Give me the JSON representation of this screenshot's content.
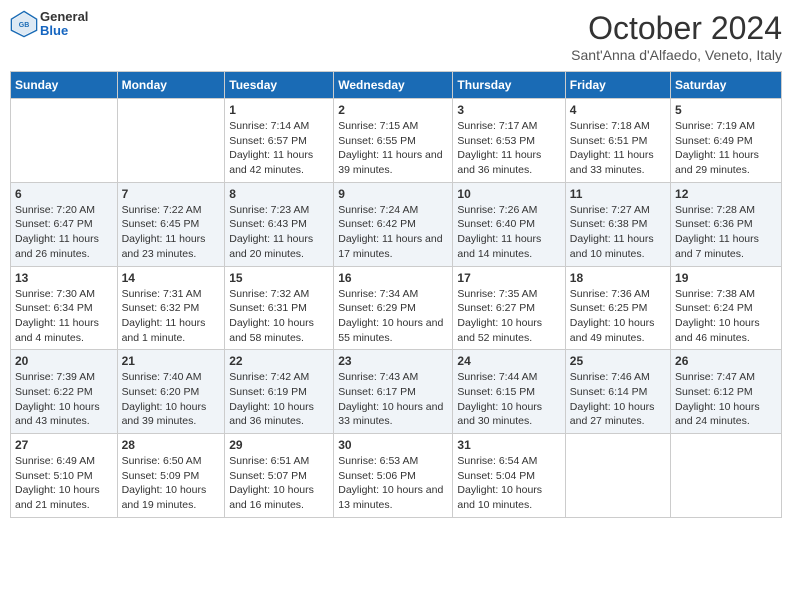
{
  "header": {
    "logo_general": "General",
    "logo_blue": "Blue",
    "month": "October 2024",
    "location": "Sant'Anna d'Alfaedo, Veneto, Italy"
  },
  "days_of_week": [
    "Sunday",
    "Monday",
    "Tuesday",
    "Wednesday",
    "Thursday",
    "Friday",
    "Saturday"
  ],
  "weeks": [
    [
      {
        "day": "",
        "info": ""
      },
      {
        "day": "",
        "info": ""
      },
      {
        "day": "1",
        "info": "Sunrise: 7:14 AM\nSunset: 6:57 PM\nDaylight: 11 hours and 42 minutes."
      },
      {
        "day": "2",
        "info": "Sunrise: 7:15 AM\nSunset: 6:55 PM\nDaylight: 11 hours and 39 minutes."
      },
      {
        "day": "3",
        "info": "Sunrise: 7:17 AM\nSunset: 6:53 PM\nDaylight: 11 hours and 36 minutes."
      },
      {
        "day": "4",
        "info": "Sunrise: 7:18 AM\nSunset: 6:51 PM\nDaylight: 11 hours and 33 minutes."
      },
      {
        "day": "5",
        "info": "Sunrise: 7:19 AM\nSunset: 6:49 PM\nDaylight: 11 hours and 29 minutes."
      }
    ],
    [
      {
        "day": "6",
        "info": "Sunrise: 7:20 AM\nSunset: 6:47 PM\nDaylight: 11 hours and 26 minutes."
      },
      {
        "day": "7",
        "info": "Sunrise: 7:22 AM\nSunset: 6:45 PM\nDaylight: 11 hours and 23 minutes."
      },
      {
        "day": "8",
        "info": "Sunrise: 7:23 AM\nSunset: 6:43 PM\nDaylight: 11 hours and 20 minutes."
      },
      {
        "day": "9",
        "info": "Sunrise: 7:24 AM\nSunset: 6:42 PM\nDaylight: 11 hours and 17 minutes."
      },
      {
        "day": "10",
        "info": "Sunrise: 7:26 AM\nSunset: 6:40 PM\nDaylight: 11 hours and 14 minutes."
      },
      {
        "day": "11",
        "info": "Sunrise: 7:27 AM\nSunset: 6:38 PM\nDaylight: 11 hours and 10 minutes."
      },
      {
        "day": "12",
        "info": "Sunrise: 7:28 AM\nSunset: 6:36 PM\nDaylight: 11 hours and 7 minutes."
      }
    ],
    [
      {
        "day": "13",
        "info": "Sunrise: 7:30 AM\nSunset: 6:34 PM\nDaylight: 11 hours and 4 minutes."
      },
      {
        "day": "14",
        "info": "Sunrise: 7:31 AM\nSunset: 6:32 PM\nDaylight: 11 hours and 1 minute."
      },
      {
        "day": "15",
        "info": "Sunrise: 7:32 AM\nSunset: 6:31 PM\nDaylight: 10 hours and 58 minutes."
      },
      {
        "day": "16",
        "info": "Sunrise: 7:34 AM\nSunset: 6:29 PM\nDaylight: 10 hours and 55 minutes."
      },
      {
        "day": "17",
        "info": "Sunrise: 7:35 AM\nSunset: 6:27 PM\nDaylight: 10 hours and 52 minutes."
      },
      {
        "day": "18",
        "info": "Sunrise: 7:36 AM\nSunset: 6:25 PM\nDaylight: 10 hours and 49 minutes."
      },
      {
        "day": "19",
        "info": "Sunrise: 7:38 AM\nSunset: 6:24 PM\nDaylight: 10 hours and 46 minutes."
      }
    ],
    [
      {
        "day": "20",
        "info": "Sunrise: 7:39 AM\nSunset: 6:22 PM\nDaylight: 10 hours and 43 minutes."
      },
      {
        "day": "21",
        "info": "Sunrise: 7:40 AM\nSunset: 6:20 PM\nDaylight: 10 hours and 39 minutes."
      },
      {
        "day": "22",
        "info": "Sunrise: 7:42 AM\nSunset: 6:19 PM\nDaylight: 10 hours and 36 minutes."
      },
      {
        "day": "23",
        "info": "Sunrise: 7:43 AM\nSunset: 6:17 PM\nDaylight: 10 hours and 33 minutes."
      },
      {
        "day": "24",
        "info": "Sunrise: 7:44 AM\nSunset: 6:15 PM\nDaylight: 10 hours and 30 minutes."
      },
      {
        "day": "25",
        "info": "Sunrise: 7:46 AM\nSunset: 6:14 PM\nDaylight: 10 hours and 27 minutes."
      },
      {
        "day": "26",
        "info": "Sunrise: 7:47 AM\nSunset: 6:12 PM\nDaylight: 10 hours and 24 minutes."
      }
    ],
    [
      {
        "day": "27",
        "info": "Sunrise: 6:49 AM\nSunset: 5:10 PM\nDaylight: 10 hours and 21 minutes."
      },
      {
        "day": "28",
        "info": "Sunrise: 6:50 AM\nSunset: 5:09 PM\nDaylight: 10 hours and 19 minutes."
      },
      {
        "day": "29",
        "info": "Sunrise: 6:51 AM\nSunset: 5:07 PM\nDaylight: 10 hours and 16 minutes."
      },
      {
        "day": "30",
        "info": "Sunrise: 6:53 AM\nSunset: 5:06 PM\nDaylight: 10 hours and 13 minutes."
      },
      {
        "day": "31",
        "info": "Sunrise: 6:54 AM\nSunset: 5:04 PM\nDaylight: 10 hours and 10 minutes."
      },
      {
        "day": "",
        "info": ""
      },
      {
        "day": "",
        "info": ""
      }
    ]
  ]
}
